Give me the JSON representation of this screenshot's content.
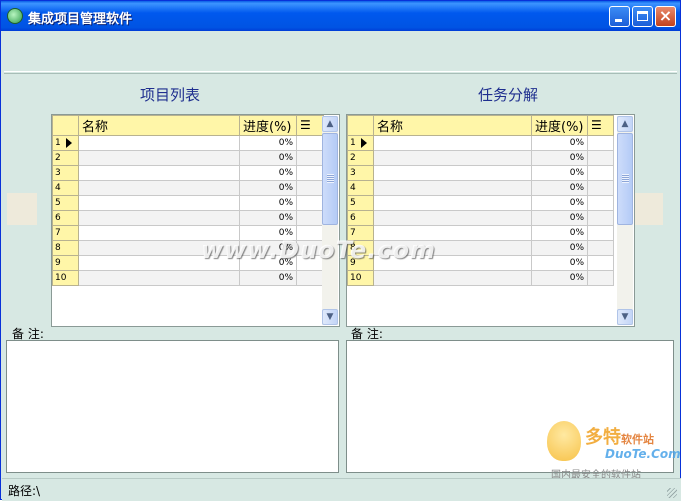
{
  "window": {
    "title": "集成项目管理软件"
  },
  "left_panel": {
    "title": "项目列表",
    "columns": [
      "名称",
      "进度(%)"
    ],
    "rows": [
      {
        "num": "1",
        "name": "",
        "progress": "0%"
      },
      {
        "num": "2",
        "name": "",
        "progress": "0%"
      },
      {
        "num": "3",
        "name": "",
        "progress": "0%"
      },
      {
        "num": "4",
        "name": "",
        "progress": "0%"
      },
      {
        "num": "5",
        "name": "",
        "progress": "0%"
      },
      {
        "num": "6",
        "name": "",
        "progress": "0%"
      },
      {
        "num": "7",
        "name": "",
        "progress": "0%"
      },
      {
        "num": "8",
        "name": "",
        "progress": "0%"
      },
      {
        "num": "9",
        "name": "",
        "progress": "0%"
      },
      {
        "num": "10",
        "name": "",
        "progress": "0%"
      }
    ],
    "notes_label": "备 注:"
  },
  "right_panel": {
    "title": "任务分解",
    "columns": [
      "名称",
      "进度(%)"
    ],
    "rows": [
      {
        "num": "1",
        "name": "",
        "progress": "0%"
      },
      {
        "num": "2",
        "name": "",
        "progress": "0%"
      },
      {
        "num": "3",
        "name": "",
        "progress": "0%"
      },
      {
        "num": "4",
        "name": "",
        "progress": "0%"
      },
      {
        "num": "5",
        "name": "",
        "progress": "0%"
      },
      {
        "num": "6",
        "name": "",
        "progress": "0%"
      },
      {
        "num": "7",
        "name": "",
        "progress": "0%"
      },
      {
        "num": "8",
        "name": "",
        "progress": "0%"
      },
      {
        "num": "9",
        "name": "",
        "progress": "0%"
      },
      {
        "num": "10",
        "name": "",
        "progress": "0%"
      }
    ],
    "notes_label": "备 注:"
  },
  "status": {
    "path": "路径:\\"
  },
  "watermark": {
    "center": "www.DuoTe.com",
    "logo_name": "多特",
    "logo_sub": "软件站",
    "logo_site": "DuoTe.Com",
    "logo_slogan": "国内最安全的软件站"
  },
  "colors": {
    "title_bar": "#0054e3",
    "background": "#d7e8e3",
    "grid_header": "#fff6a8",
    "section_title": "#1f2f8f"
  }
}
